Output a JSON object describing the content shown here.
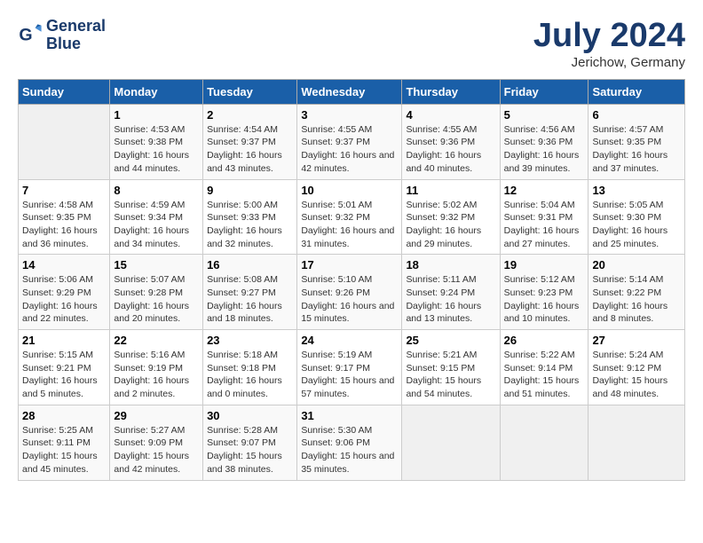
{
  "header": {
    "logo_line1": "General",
    "logo_line2": "Blue",
    "month_title": "July 2024",
    "location": "Jerichow, Germany"
  },
  "calendar": {
    "days_of_week": [
      "Sunday",
      "Monday",
      "Tuesday",
      "Wednesday",
      "Thursday",
      "Friday",
      "Saturday"
    ],
    "weeks": [
      [
        {
          "day": "",
          "empty": true
        },
        {
          "day": "1",
          "sunrise": "4:53 AM",
          "sunset": "9:38 PM",
          "daylight": "16 hours and 44 minutes."
        },
        {
          "day": "2",
          "sunrise": "4:54 AM",
          "sunset": "9:37 PM",
          "daylight": "16 hours and 43 minutes."
        },
        {
          "day": "3",
          "sunrise": "4:55 AM",
          "sunset": "9:37 PM",
          "daylight": "16 hours and 42 minutes."
        },
        {
          "day": "4",
          "sunrise": "4:55 AM",
          "sunset": "9:36 PM",
          "daylight": "16 hours and 40 minutes."
        },
        {
          "day": "5",
          "sunrise": "4:56 AM",
          "sunset": "9:36 PM",
          "daylight": "16 hours and 39 minutes."
        },
        {
          "day": "6",
          "sunrise": "4:57 AM",
          "sunset": "9:35 PM",
          "daylight": "16 hours and 37 minutes."
        }
      ],
      [
        {
          "day": "7",
          "sunrise": "4:58 AM",
          "sunset": "9:35 PM",
          "daylight": "16 hours and 36 minutes."
        },
        {
          "day": "8",
          "sunrise": "4:59 AM",
          "sunset": "9:34 PM",
          "daylight": "16 hours and 34 minutes."
        },
        {
          "day": "9",
          "sunrise": "5:00 AM",
          "sunset": "9:33 PM",
          "daylight": "16 hours and 32 minutes."
        },
        {
          "day": "10",
          "sunrise": "5:01 AM",
          "sunset": "9:32 PM",
          "daylight": "16 hours and 31 minutes."
        },
        {
          "day": "11",
          "sunrise": "5:02 AM",
          "sunset": "9:32 PM",
          "daylight": "16 hours and 29 minutes."
        },
        {
          "day": "12",
          "sunrise": "5:04 AM",
          "sunset": "9:31 PM",
          "daylight": "16 hours and 27 minutes."
        },
        {
          "day": "13",
          "sunrise": "5:05 AM",
          "sunset": "9:30 PM",
          "daylight": "16 hours and 25 minutes."
        }
      ],
      [
        {
          "day": "14",
          "sunrise": "5:06 AM",
          "sunset": "9:29 PM",
          "daylight": "16 hours and 22 minutes."
        },
        {
          "day": "15",
          "sunrise": "5:07 AM",
          "sunset": "9:28 PM",
          "daylight": "16 hours and 20 minutes."
        },
        {
          "day": "16",
          "sunrise": "5:08 AM",
          "sunset": "9:27 PM",
          "daylight": "16 hours and 18 minutes."
        },
        {
          "day": "17",
          "sunrise": "5:10 AM",
          "sunset": "9:26 PM",
          "daylight": "16 hours and 15 minutes."
        },
        {
          "day": "18",
          "sunrise": "5:11 AM",
          "sunset": "9:24 PM",
          "daylight": "16 hours and 13 minutes."
        },
        {
          "day": "19",
          "sunrise": "5:12 AM",
          "sunset": "9:23 PM",
          "daylight": "16 hours and 10 minutes."
        },
        {
          "day": "20",
          "sunrise": "5:14 AM",
          "sunset": "9:22 PM",
          "daylight": "16 hours and 8 minutes."
        }
      ],
      [
        {
          "day": "21",
          "sunrise": "5:15 AM",
          "sunset": "9:21 PM",
          "daylight": "16 hours and 5 minutes."
        },
        {
          "day": "22",
          "sunrise": "5:16 AM",
          "sunset": "9:19 PM",
          "daylight": "16 hours and 2 minutes."
        },
        {
          "day": "23",
          "sunrise": "5:18 AM",
          "sunset": "9:18 PM",
          "daylight": "16 hours and 0 minutes."
        },
        {
          "day": "24",
          "sunrise": "5:19 AM",
          "sunset": "9:17 PM",
          "daylight": "15 hours and 57 minutes."
        },
        {
          "day": "25",
          "sunrise": "5:21 AM",
          "sunset": "9:15 PM",
          "daylight": "15 hours and 54 minutes."
        },
        {
          "day": "26",
          "sunrise": "5:22 AM",
          "sunset": "9:14 PM",
          "daylight": "15 hours and 51 minutes."
        },
        {
          "day": "27",
          "sunrise": "5:24 AM",
          "sunset": "9:12 PM",
          "daylight": "15 hours and 48 minutes."
        }
      ],
      [
        {
          "day": "28",
          "sunrise": "5:25 AM",
          "sunset": "9:11 PM",
          "daylight": "15 hours and 45 minutes."
        },
        {
          "day": "29",
          "sunrise": "5:27 AM",
          "sunset": "9:09 PM",
          "daylight": "15 hours and 42 minutes."
        },
        {
          "day": "30",
          "sunrise": "5:28 AM",
          "sunset": "9:07 PM",
          "daylight": "15 hours and 38 minutes."
        },
        {
          "day": "31",
          "sunrise": "5:30 AM",
          "sunset": "9:06 PM",
          "daylight": "15 hours and 35 minutes."
        },
        {
          "day": "",
          "empty": true
        },
        {
          "day": "",
          "empty": true
        },
        {
          "day": "",
          "empty": true
        }
      ]
    ]
  }
}
